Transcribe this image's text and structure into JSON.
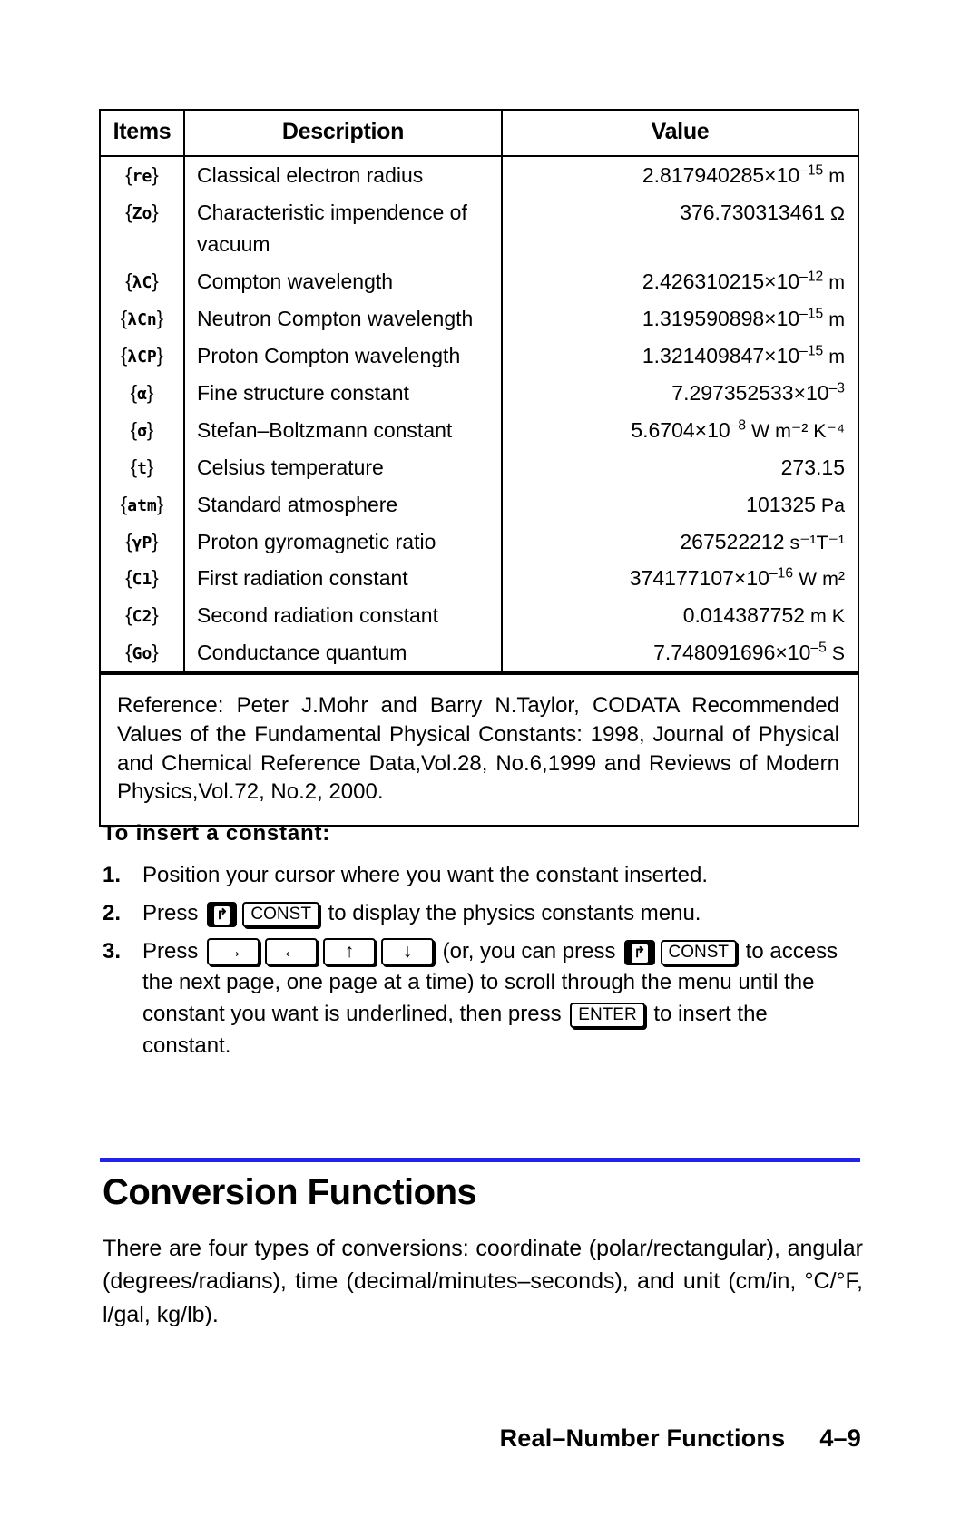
{
  "table": {
    "headers": [
      "Items",
      "Description",
      "Value"
    ],
    "rows": [
      {
        "item": "{re}",
        "item_plain": "re",
        "desc": "Classical electron radius",
        "mantissa": "2.817940285×10",
        "exp": "–15",
        "unit": " m"
      },
      {
        "item": "{Zo}",
        "item_plain": "Zo",
        "desc": "Characteristic impendence of vacuum",
        "mantissa": "376.730313461",
        "exp": "",
        "unit": " Ω"
      },
      {
        "item": "{λC}",
        "item_plain": "λC",
        "desc": "Compton wavelength",
        "mantissa": "2.426310215×10",
        "exp": "–12",
        "unit": " m"
      },
      {
        "item": "{λCn}",
        "item_plain": "λCn",
        "desc": "Neutron Compton wavelength",
        "mantissa": "1.319590898×10",
        "exp": "–15",
        "unit": " m"
      },
      {
        "item": "{λCP}",
        "item_plain": "λCP",
        "desc": "Proton Compton wavelength",
        "mantissa": "1.321409847×10",
        "exp": "–15",
        "unit": " m"
      },
      {
        "item": "{α}",
        "item_plain": "α",
        "desc": "Fine structure constant",
        "mantissa": "7.297352533×10",
        "exp": "–3",
        "unit": ""
      },
      {
        "item": "{σ}",
        "item_plain": "σ",
        "desc": "Stefan–Boltzmann constant",
        "mantissa": "5.6704×10",
        "exp": "–8",
        "unit": " W m⁻² K⁻⁴"
      },
      {
        "item": "{t}",
        "item_plain": "t",
        "desc": "Celsius temperature",
        "mantissa": "273.15",
        "exp": "",
        "unit": ""
      },
      {
        "item": "{atm}",
        "item_plain": "atm",
        "desc": "Standard atmosphere",
        "mantissa": "101325",
        "exp": "",
        "unit": " Pa"
      },
      {
        "item": "{γP}",
        "item_plain": "γP",
        "desc": "Proton gyromagnetic ratio",
        "mantissa": "267522212",
        "exp": "",
        "unit": " s⁻¹T⁻¹"
      },
      {
        "item": "{C1}",
        "item_plain": "C1",
        "desc": "First radiation constant",
        "mantissa": "374177107×10",
        "exp": "–16",
        "unit": " W m²"
      },
      {
        "item": "{C2}",
        "item_plain": "C2",
        "desc": "Second radiation constant",
        "mantissa": "0.014387752",
        "exp": "",
        "unit": " m K"
      },
      {
        "item": "{Go}",
        "item_plain": "Go",
        "desc": "Conductance quantum",
        "mantissa": "7.748091696×10",
        "exp": "–5",
        "unit": " S"
      }
    ],
    "reference": "Reference: Peter J.Mohr and Barry N.Taylor, CODATA Recommended Values of the Fundamental Physical Constants: 1998, Journal of Physical and Chemical Reference Data,Vol.28, No.6,1999 and Reviews of Modern Physics,Vol.72, No.2, 2000."
  },
  "procedure": {
    "title": "To insert a constant:",
    "steps": [
      {
        "num": "1.",
        "segments": [
          {
            "type": "text",
            "value": "Position your cursor where you want the constant inserted."
          }
        ]
      },
      {
        "num": "2.",
        "segments": [
          {
            "type": "text",
            "value": "Press "
          },
          {
            "type": "key-shift",
            "value": "↱"
          },
          {
            "type": "key",
            "value": "CONST"
          },
          {
            "type": "text",
            "value": " to display the physics constants menu."
          }
        ]
      },
      {
        "num": "3.",
        "segments": [
          {
            "type": "text",
            "value": "Press "
          },
          {
            "type": "key-arrow",
            "value": "→"
          },
          {
            "type": "key-arrow",
            "value": "←"
          },
          {
            "type": "key-arrow",
            "value": "↑"
          },
          {
            "type": "key-arrow",
            "value": "↓"
          },
          {
            "type": "text",
            "value": " (or, you can press "
          },
          {
            "type": "key-shift",
            "value": "↱"
          },
          {
            "type": "key",
            "value": "CONST"
          },
          {
            "type": "text",
            "value": " to access the next page, one page at a time) to scroll through the menu until the constant you want is underlined, then press "
          },
          {
            "type": "key",
            "value": "ENTER"
          },
          {
            "type": "text",
            "value": " to insert the constant."
          }
        ]
      }
    ]
  },
  "section": {
    "heading": "Conversion Functions",
    "paragraph": "There are four types of conversions: coordinate (polar/rectangular), angular (degrees/radians), time (decimal/minutes–seconds), and unit (cm/in, °C/°F, l/gal, kg/lb).",
    "rule_color": "#2222ee"
  },
  "footer": {
    "chapter_title": "Real–Number Functions",
    "page_number": "4–9"
  }
}
